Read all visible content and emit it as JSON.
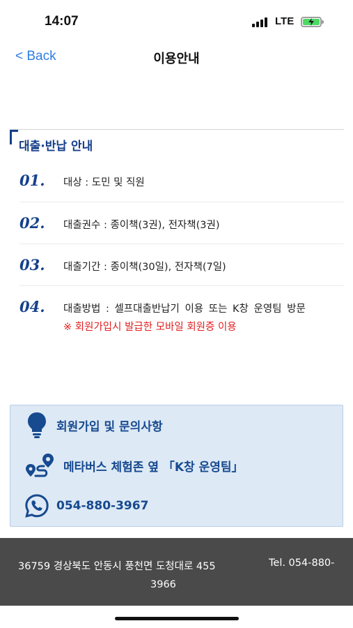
{
  "status_bar": {
    "time": "14:07",
    "network": "LTE"
  },
  "nav": {
    "back_label": "< Back",
    "title": "이용안내"
  },
  "section": {
    "title": "대출·반납 안내",
    "items": [
      {
        "num": "01.",
        "text": "대상 : 도민 및 직원"
      },
      {
        "num": "02.",
        "text": "대출권수 : 종이책(3권), 전자책(3권)"
      },
      {
        "num": "03.",
        "text": "대출기간 : 종이책(30일), 전자책(7일)"
      },
      {
        "num": "04.",
        "text": "대출방법 : 셀프대출반납기 이용 또는 K창 운영팀 방문",
        "note": "※ 회원가입시 발급한 모바일 회원증 이용"
      }
    ]
  },
  "info": {
    "inquiry_label": "회원가입 및 문의사항",
    "location_label": "메타버스 체험존 옆 「K창 운영팀」",
    "phone": "054-880-3967",
    "accent_color": "#174a8f",
    "background_color": "#dde9f5"
  },
  "footer": {
    "address": "36759 경상북도 안동시 풍천면 도청대로 455",
    "tel_label": "Tel. 054-880-",
    "tel_rest": "3966"
  }
}
